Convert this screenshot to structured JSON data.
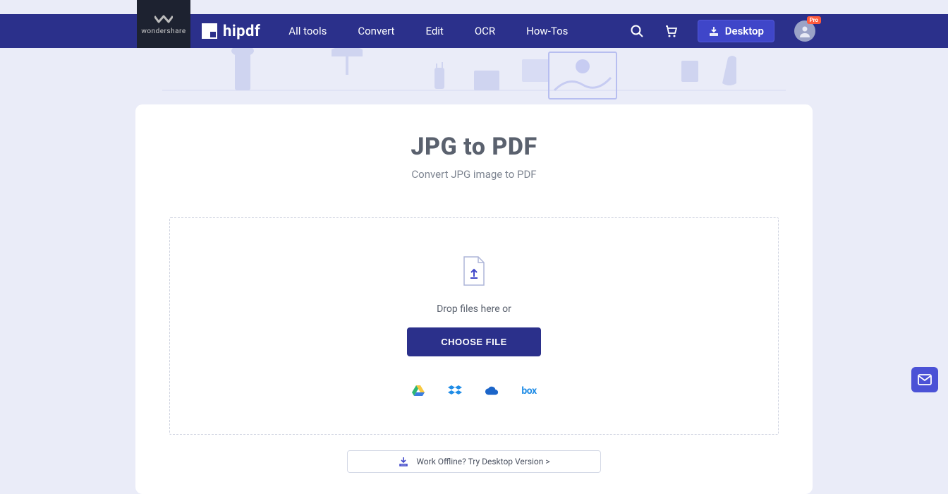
{
  "brand": {
    "parent": "wondershare",
    "product": "hipdf"
  },
  "nav": {
    "links": [
      "All tools",
      "Convert",
      "Edit",
      "OCR",
      "How-Tos"
    ],
    "desktop_label": "Desktop",
    "pro_badge": "Pro"
  },
  "page": {
    "title": "JPG to PDF",
    "subtitle": "Convert JPG image to PDF"
  },
  "dropzone": {
    "drop_text": "Drop files here or",
    "choose_label": "CHOOSE FILE"
  },
  "cloud_sources": [
    {
      "name": "google-drive"
    },
    {
      "name": "dropbox"
    },
    {
      "name": "onedrive"
    },
    {
      "name": "box",
      "label": "box"
    }
  ],
  "offline": {
    "text": "Work Offline? Try Desktop Version >"
  }
}
